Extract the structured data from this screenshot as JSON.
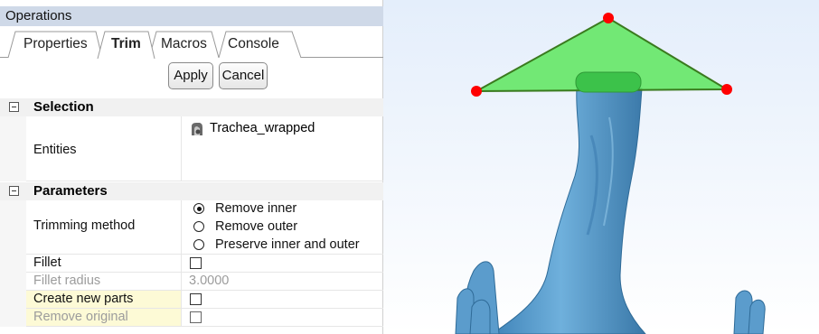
{
  "panel_title": "Operations",
  "tabs": [
    {
      "label": "Properties",
      "active": false
    },
    {
      "label": "Trim",
      "active": true
    },
    {
      "label": "Macros",
      "active": false
    },
    {
      "label": "Console",
      "active": false
    }
  ],
  "buttons": {
    "apply": "Apply",
    "cancel": "Cancel"
  },
  "selection": {
    "header": "Selection",
    "entities_label": "Entities",
    "entity_name": "Trachea_wrapped",
    "entity_icon": "part-icon"
  },
  "parameters": {
    "header": "Parameters",
    "trimming_method_label": "Trimming method",
    "trimming_options": [
      "Remove inner",
      "Remove outer",
      "Preserve inner and outer"
    ],
    "trimming_selected": "Remove inner",
    "fillet_label": "Fillet",
    "fillet_checked": false,
    "fillet_radius_label": "Fillet radius",
    "fillet_radius_value": "3.0000",
    "create_new_parts_label": "Create new parts",
    "create_new_parts_checked": false,
    "remove_original_label": "Remove original",
    "remove_original_checked": false
  },
  "viewport": {
    "background": "#e4eefb",
    "model_color": "#5b9ccc",
    "trim_plane_color": "#5de65d",
    "control_point_color": "#ff0000"
  }
}
